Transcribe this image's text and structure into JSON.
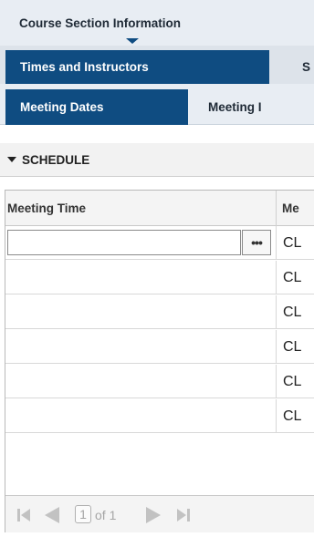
{
  "tabs": {
    "top_active": "Course Section Information",
    "mid_active": "Times and Instructors",
    "mid_next": "S",
    "sub_active": "Meeting Dates",
    "sub_next": "Meeting I"
  },
  "section": {
    "title": "SCHEDULE"
  },
  "grid": {
    "columns": [
      "Meeting Time",
      "Me"
    ],
    "rows": [
      {
        "meeting_time": "",
        "code": "CL"
      },
      {
        "meeting_time": "",
        "code": "CL"
      },
      {
        "meeting_time": "",
        "code": "CL"
      },
      {
        "meeting_time": "",
        "code": "CL"
      },
      {
        "meeting_time": "",
        "code": "CL"
      },
      {
        "meeting_time": "",
        "code": "CL"
      }
    ],
    "lookup_label": "•••"
  },
  "pager": {
    "page": "1",
    "of_label": "of 1"
  },
  "colors": {
    "accent": "#0f4c81",
    "tab_bg": "#e8edf3",
    "disabled": "#a5a5a5"
  }
}
